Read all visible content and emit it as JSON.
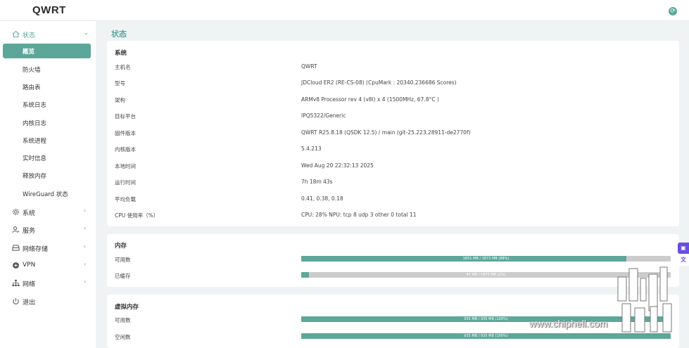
{
  "header": {
    "brand": "QWRT"
  },
  "sidebar": {
    "status_group": {
      "label": "状态"
    },
    "status_items": [
      {
        "label": "概览",
        "active": true
      },
      {
        "label": "防火墙"
      },
      {
        "label": "路由表"
      },
      {
        "label": "系统日志"
      },
      {
        "label": "内核日志"
      },
      {
        "label": "系统进程"
      },
      {
        "label": "实时信息"
      },
      {
        "label": "释放内存"
      },
      {
        "label": "WireGuard 状态"
      }
    ],
    "groups": [
      {
        "label": "系统",
        "icon": "gear-icon"
      },
      {
        "label": "服务",
        "icon": "user-service-icon"
      },
      {
        "label": "网络存储",
        "icon": "storage-icon"
      },
      {
        "label": "VPN",
        "icon": "vpn-icon"
      },
      {
        "label": "网络",
        "icon": "network-icon"
      },
      {
        "label": "退出",
        "icon": "power-icon"
      }
    ]
  },
  "page": {
    "title": "状态"
  },
  "system": {
    "title": "系统",
    "rows": [
      {
        "label": "主机名",
        "value": "QWRT"
      },
      {
        "label": "型号",
        "value": "JDCloud ER2 (RE-CS-08) (CpuMark : 20340.236686 Scores)"
      },
      {
        "label": "架构",
        "value": "ARMv8 Processor rev 4 (v8l) x 4 (1500MHz, 67.8°C )"
      },
      {
        "label": "目标平台",
        "value": "IPQ5322/Generic"
      },
      {
        "label": "固件版本",
        "value": "QWRT R25.8.18 (QSDK 12.5) / main (git-25.223.28911-de2770f)"
      },
      {
        "label": "内核版本",
        "value": "5.4.213"
      },
      {
        "label": "本地时间",
        "value": "Wed Aug 20 22:32:13 2025"
      },
      {
        "label": "运行时间",
        "value": "7h 18m 43s"
      },
      {
        "label": "平均负载",
        "value": "0.41, 0.38, 0.18"
      },
      {
        "label": "CPU 使用率（%）",
        "value": "CPU: 28% NPU: tcp 8 udp 3 other 0 total 11"
      }
    ]
  },
  "memory": {
    "title": "内存",
    "rows": [
      {
        "label": "可用数",
        "bar_text": "1651 MB / 1873 MB (88%)",
        "fraction": 0.88
      },
      {
        "label": "已缓存",
        "bar_text": "47 MB / 1873 MB (2%)",
        "fraction": 0.02
      }
    ]
  },
  "swap": {
    "title": "虚拟内存",
    "rows": [
      {
        "label": "可用数",
        "bar_text": "935 MB / 935 MB (100%)",
        "fraction": 1.0
      },
      {
        "label": "空闲数",
        "bar_text": "935 MB / 935 MB (100%)",
        "fraction": 1.0
      }
    ]
  },
  "watermark": {
    "site": "www.chiphell.com"
  },
  "colors": {
    "accent": "#5ca79a",
    "bar_bg": "#cccccc",
    "float_btn": "#6a4ee0"
  }
}
